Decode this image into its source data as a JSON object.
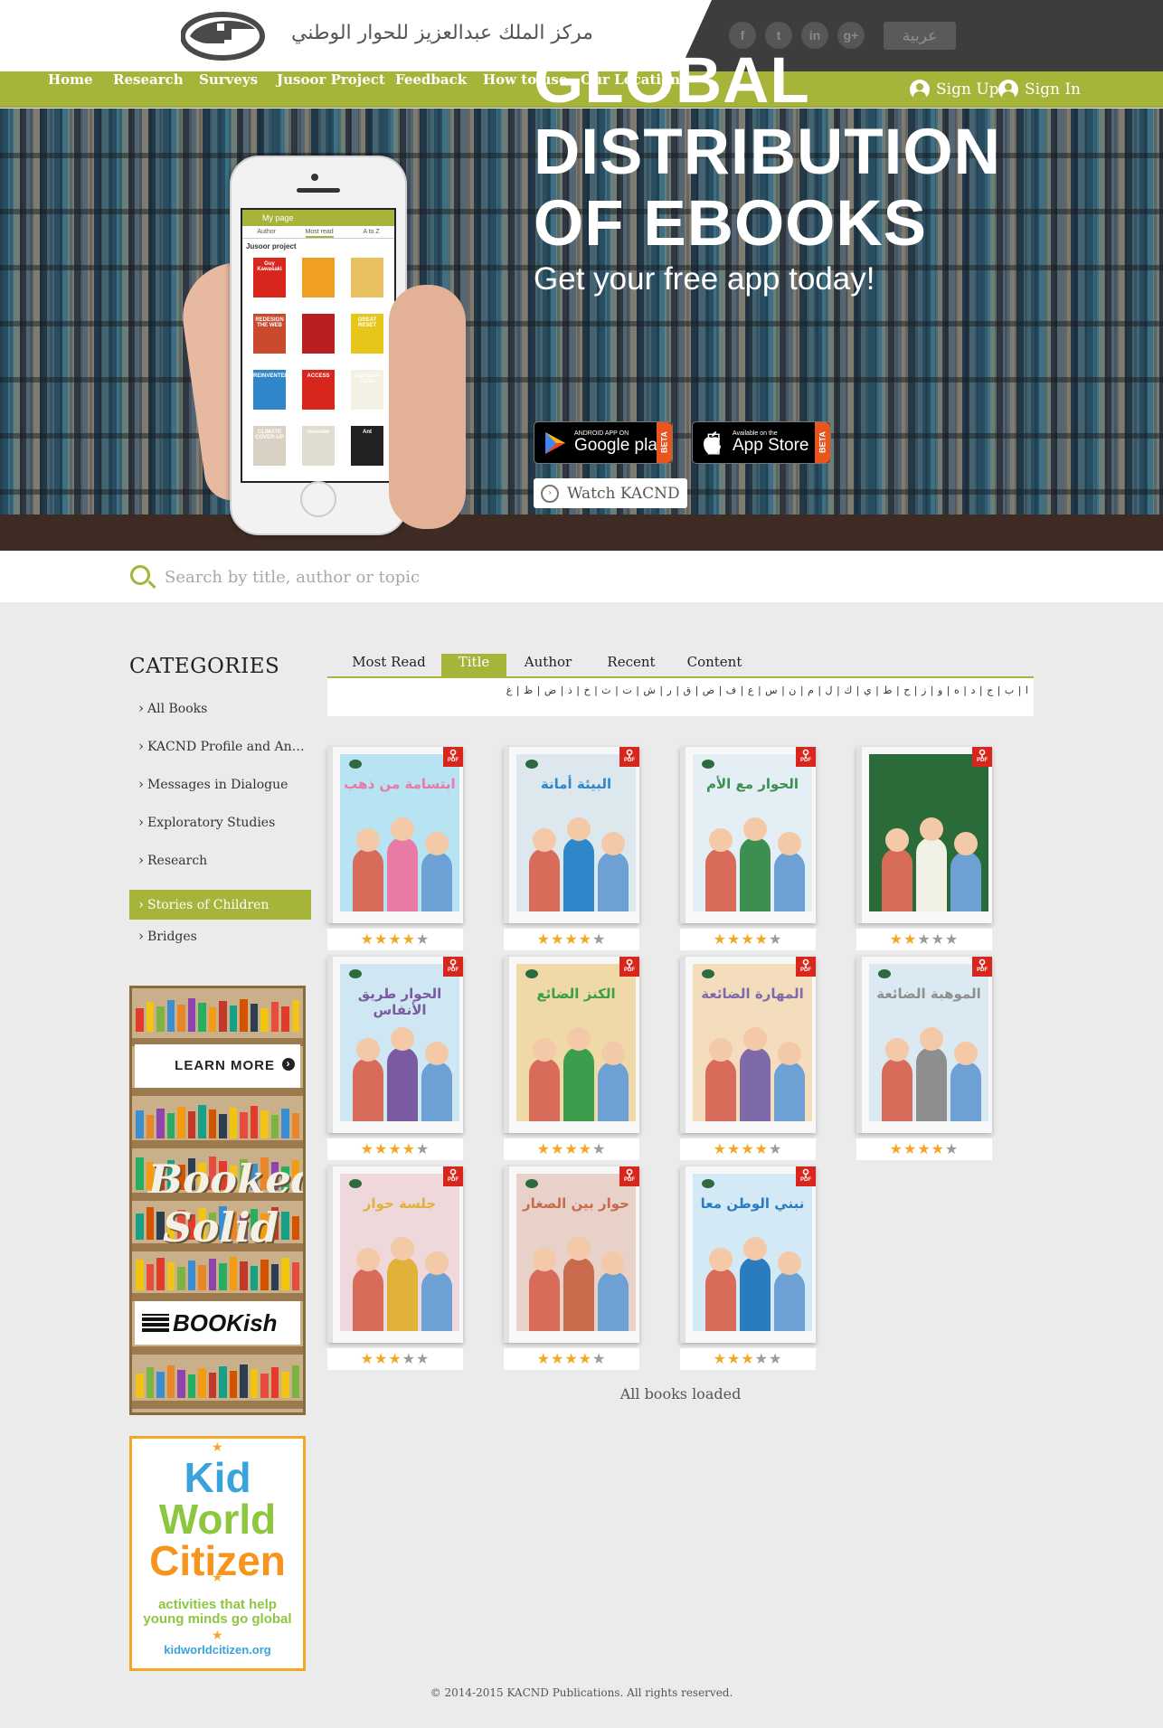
{
  "header": {
    "logo_text": "مركز الملك عبدالعزيز للحوار الوطني",
    "social": [
      {
        "icon": "facebook-icon",
        "glyph": "f"
      },
      {
        "icon": "twitter-icon",
        "glyph": "t"
      },
      {
        "icon": "linkedin-icon",
        "glyph": "in"
      },
      {
        "icon": "googleplus-icon",
        "glyph": "g+"
      }
    ],
    "language_button": "عربية"
  },
  "nav": {
    "items": [
      "Home",
      "Research",
      "Surveys",
      "Jusoor Project",
      "Feedback",
      "How to use",
      "Our Location"
    ],
    "sign_up": "Sign Up",
    "sign_in": "Sign In"
  },
  "hero": {
    "title_lines": [
      "GLOBAL",
      "DISTRIBUTION",
      "OF EBOOKS"
    ],
    "subtitle": "Get your free app today!",
    "google_play": {
      "small": "ANDROID APP ON",
      "big": "Google play",
      "badge": "BETA"
    },
    "app_store": {
      "small": "Available on the",
      "big": "App Store",
      "badge": "BETA"
    },
    "watch_label": "Watch KACND",
    "phone": {
      "title": "My page",
      "tabs": [
        "Author",
        "Most read",
        "A to Z"
      ],
      "section": "Jusoor project",
      "mini_titles": [
        "Guy Kawasaki",
        "",
        "",
        "REDESIGN THE WEB",
        "",
        "GREAT RESET",
        "REINVENTED",
        "ACCESS",
        "Bad Luck Cadet",
        "CLIMATE COVER-UP",
        "resonate",
        "Ant"
      ]
    }
  },
  "search": {
    "placeholder": "Search by title, author or topic"
  },
  "sidebar": {
    "title": "CATEGORIES",
    "items": [
      "All Books",
      "KACND Profile and Annual Reports",
      "Messages in Dialogue",
      "Exploratory Studies",
      "Research",
      "Stories of Children",
      "Bridges"
    ],
    "active_index": 5,
    "ad1": {
      "learn_more": "LEARN MORE",
      "line1": "Booked",
      "line2": "Solid",
      "bookish": "BOOKish"
    },
    "ad2": {
      "line1": "Kid",
      "line2": "World",
      "line3": "Citizen",
      "tagline": "activities that help young minds go global",
      "url": "kidworldcitizen.org"
    }
  },
  "tabs": {
    "items": [
      "Most Read",
      "Title",
      "Author",
      "Recent",
      "Content"
    ],
    "active": "Title"
  },
  "alphabet": "ا | ب | ج | د | ه | و | ز | ح | ط | ي | ك | ل | م | ن | س | ع | ف | ص | ق | ر | ش | ت | ث | خ | ذ | ض | ظ | غ",
  "books": [
    {
      "title": "ابتسامة من ذهب",
      "rating": 4,
      "cover": "#b7e3f2",
      "accent": "#e97aa6"
    },
    {
      "title": "البيئة أمانة",
      "rating": 4,
      "cover": "#dde8ee",
      "accent": "#2f86c8"
    },
    {
      "title": "الحوار مع الأم",
      "rating": 4,
      "cover": "#e4eef5",
      "accent": "#3c8f50"
    },
    {
      "title": "",
      "rating": 2,
      "cover": "#2b6b3a",
      "accent": "#f1f1e6"
    },
    {
      "title": "الحوار طريق الأنفاس",
      "rating": 4,
      "cover": "#cfe7f3",
      "accent": "#7a5aa0"
    },
    {
      "title": "الكنز الضائع",
      "rating": 4,
      "cover": "#f0d9a9",
      "accent": "#3c9d4c"
    },
    {
      "title": "المهارة الضائعة",
      "rating": 4,
      "cover": "#f4ddbd",
      "accent": "#7e6aa8"
    },
    {
      "title": "الموهبة الضائعة",
      "rating": 4,
      "cover": "#dbe9f2",
      "accent": "#8e8e8e"
    },
    {
      "title": "جلسة حوار",
      "rating": 3,
      "cover": "#efd8db",
      "accent": "#e0b23a"
    },
    {
      "title": "حوار بين الصغار",
      "rating": 4,
      "cover": "#e7d1c9",
      "accent": "#c86b4c"
    },
    {
      "title": "نبني الوطن معا",
      "rating": 3,
      "cover": "#d4e9f6",
      "accent": "#2b7bbf"
    }
  ],
  "status": "All books loaded",
  "footer": "© 2014-2015 KACND Publications. All rights reserved."
}
